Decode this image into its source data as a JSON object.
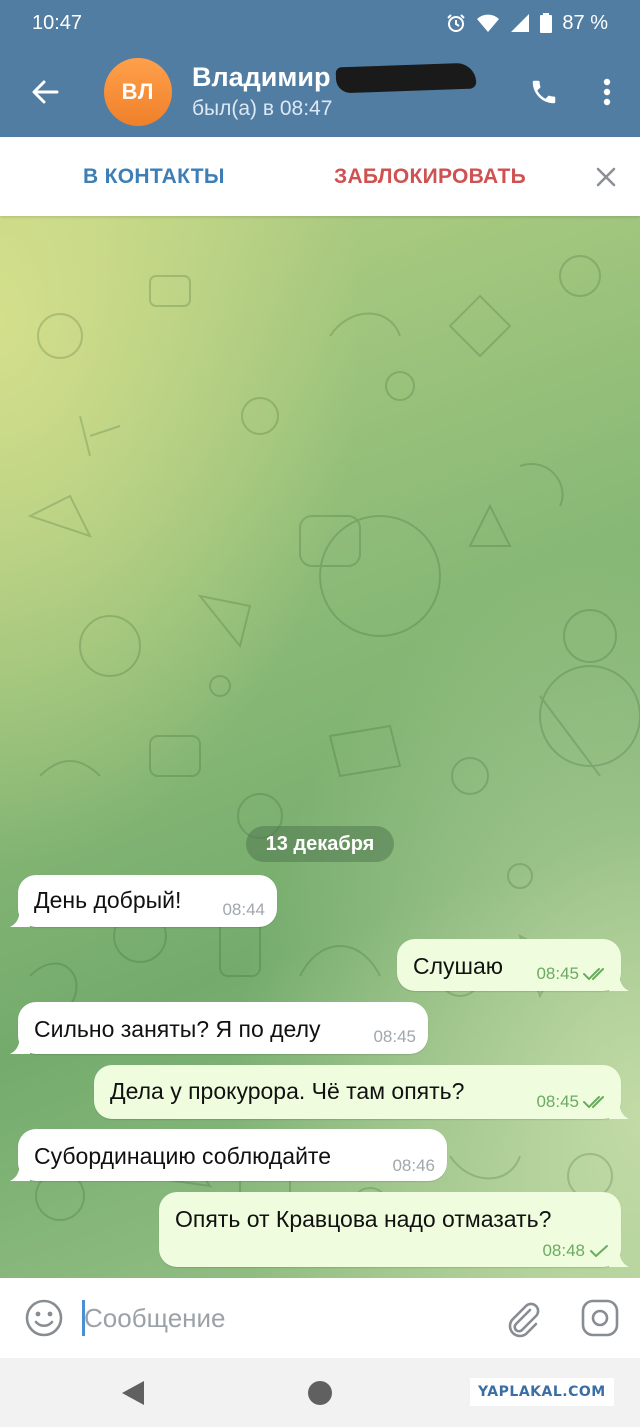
{
  "status_bar": {
    "time": "10:47",
    "battery": "87 %"
  },
  "header": {
    "avatar_initials": "ВЛ",
    "contact_name": "Владимир",
    "last_seen": "был(а) в 08:47"
  },
  "action_bar": {
    "add_contact": "В КОНТАКТЫ",
    "block": "ЗАБЛОКИРОВАТЬ"
  },
  "chat": {
    "date_label": "13 декабря",
    "messages": [
      {
        "direction": "in",
        "text": "День добрый!",
        "time": "08:44"
      },
      {
        "direction": "out",
        "text": "Слушаю",
        "time": "08:45",
        "status": "read"
      },
      {
        "direction": "in",
        "text": "Сильно заняты? Я по делу",
        "time": "08:45"
      },
      {
        "direction": "out",
        "text": "Дела у прокурора. Чё там опять?",
        "time": "08:45",
        "status": "read"
      },
      {
        "direction": "in",
        "text": "Субординацию соблюдайте",
        "time": "08:46"
      },
      {
        "direction": "out",
        "text": "Опять от Кравцова надо отмазать?",
        "time": "08:48",
        "status": "sent"
      }
    ]
  },
  "input": {
    "placeholder": "Сообщение"
  },
  "watermark": "YAPLAKAL.COM",
  "colors": {
    "header_bg": "#527da3",
    "outgoing_bubble": "#effdde",
    "incoming_bubble": "#ffffff",
    "avatar": "#f58f3a",
    "block_red": "#cf5151",
    "contacts_blue": "#3e7eb6"
  }
}
